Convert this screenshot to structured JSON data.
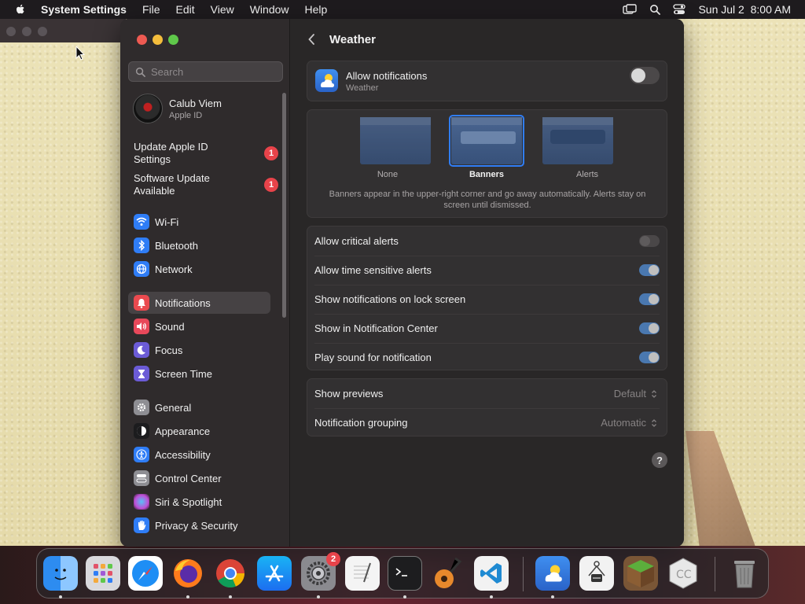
{
  "menubar": {
    "app_name": "System Settings",
    "items": [
      "File",
      "Edit",
      "View",
      "Window",
      "Help"
    ],
    "clock": "Sun Jul 2  8:00 AM"
  },
  "sidebar": {
    "search_placeholder": "Search",
    "account": {
      "name": "Calub Viem",
      "subtitle": "Apple ID"
    },
    "alerts": [
      {
        "label": "Update Apple ID Settings",
        "badge": "1"
      },
      {
        "label": "Software Update Available",
        "badge": "1"
      }
    ],
    "items": [
      {
        "label": "Wi-Fi",
        "icon": "wifi-icon",
        "color": "#2f7df6"
      },
      {
        "label": "Bluetooth",
        "icon": "bluetooth-icon",
        "color": "#2f7df6"
      },
      {
        "label": "Network",
        "icon": "globe-icon",
        "color": "#2f7df6"
      },
      {
        "label": "Notifications",
        "icon": "bell-icon",
        "color": "#ea4a4f",
        "selected": true
      },
      {
        "label": "Sound",
        "icon": "speaker-icon",
        "color": "#e8485a"
      },
      {
        "label": "Focus",
        "icon": "moon-icon",
        "color": "#6b5bd6"
      },
      {
        "label": "Screen Time",
        "icon": "hourglass-icon",
        "color": "#6b5bd6"
      },
      {
        "label": "General",
        "icon": "gear-icon",
        "color": "#8e8e93"
      },
      {
        "label": "Appearance",
        "icon": "appearance-icon",
        "color": "#1c1c1e"
      },
      {
        "label": "Accessibility",
        "icon": "accessibility-icon",
        "color": "#2f7df6"
      },
      {
        "label": "Control Center",
        "icon": "control-center-icon",
        "color": "#8e8e93"
      },
      {
        "label": "Siri & Spotlight",
        "icon": "siri-icon",
        "color": "#c04fd6"
      },
      {
        "label": "Privacy & Security",
        "icon": "hand-icon",
        "color": "#2f7df6"
      }
    ]
  },
  "content": {
    "title": "Weather",
    "allow": {
      "label": "Allow notifications",
      "sub": "Weather",
      "on": false
    },
    "styles": [
      {
        "label": "None",
        "selected": false
      },
      {
        "label": "Banners",
        "selected": true
      },
      {
        "label": "Alerts",
        "selected": false
      }
    ],
    "style_description": "Banners appear in the upper-right corner and go away automatically. Alerts stay on screen until dismissed.",
    "options": [
      {
        "label": "Allow critical alerts",
        "on": false
      },
      {
        "label": "Allow time sensitive alerts",
        "on": true
      },
      {
        "label": "Show notifications on lock screen",
        "on": true
      },
      {
        "label": "Show in Notification Center",
        "on": true
      },
      {
        "label": "Play sound for notification",
        "on": true
      }
    ],
    "selects": [
      {
        "label": "Show previews",
        "value": "Default"
      },
      {
        "label": "Notification grouping",
        "value": "Automatic"
      }
    ],
    "help_label": "?"
  },
  "dock": {
    "settings_badge": "2",
    "apps": [
      "finder",
      "launchpad",
      "safari",
      "firefox",
      "chrome",
      "app-store",
      "system-settings",
      "textedit",
      "terminal",
      "garageband",
      "vscode",
      "weather",
      "automator",
      "minecraft",
      "cc-app",
      "trash"
    ]
  }
}
